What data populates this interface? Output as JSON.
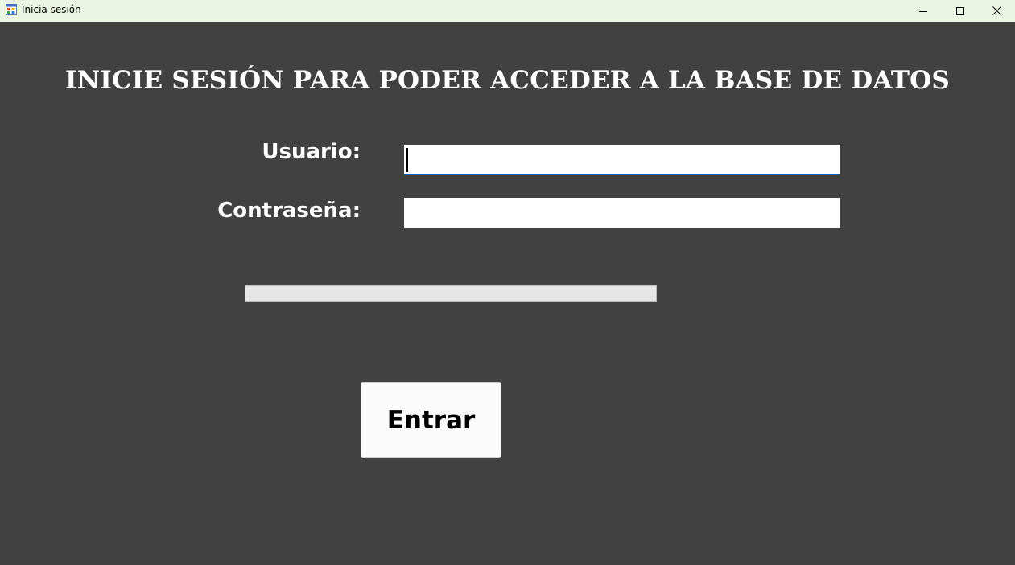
{
  "window": {
    "title": "Inicia sesión",
    "icon": "windows-form-icon",
    "controls": {
      "minimize": "minimize-icon",
      "maximize": "maximize-icon",
      "close": "close-icon"
    }
  },
  "form": {
    "heading": "INICIE SESIÓN PARA PODER ACCEDER A LA BASE DE DATOS",
    "user_label": "Usuario:",
    "user_value": "",
    "password_label": "Contraseña:",
    "password_value": "",
    "progress_percent": 0,
    "submit_label": "Entrar"
  },
  "colors": {
    "background": "#414141",
    "titlebar": "#ebf5e3",
    "input_focus_border": "#0a5fa8",
    "button_background": "#fbfbfb",
    "progress_track": "#e6e6e6"
  }
}
